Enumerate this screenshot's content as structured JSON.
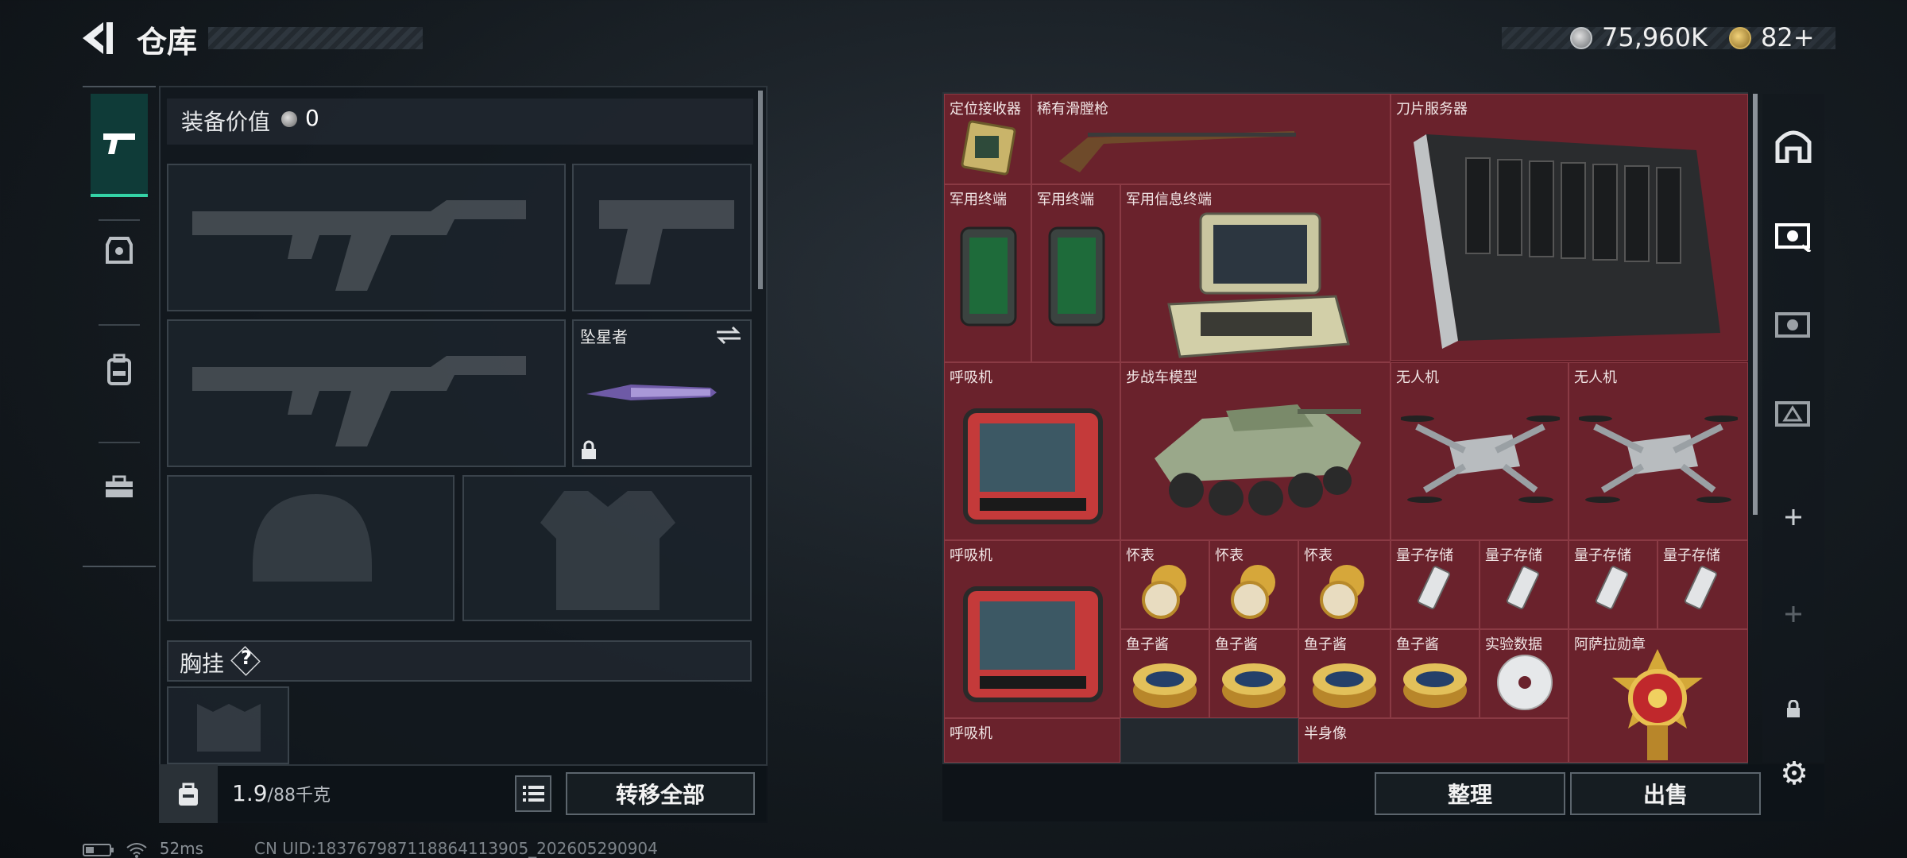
{
  "header": {
    "title": "仓库",
    "back_icon": "back-arrow-icon",
    "currency1_value": "75,960K",
    "currency2_value": "82+"
  },
  "loadout": {
    "equip_value_label": "装备价值",
    "equip_value": "0",
    "melee_name": "坠星者",
    "chest_rig_label": "胸挂",
    "chest_rig_help": "?",
    "weight_value": "1.9",
    "weight_limit": "/88千克",
    "move_all_label": "转移全部"
  },
  "left_tabs": [
    "pistol-icon",
    "armor-icon",
    "backpack-icon",
    "case-icon"
  ],
  "storage": {
    "items": [
      {
        "name": "定位接收器",
        "icon": "receiver-icon"
      },
      {
        "name": "稀有滑膛枪",
        "icon": "musket-icon"
      },
      {
        "name": "刀片服务器",
        "icon": "blade-server-icon"
      },
      {
        "name": "军用终端",
        "icon": "military-terminal-icon"
      },
      {
        "name": "军用终端",
        "icon": "military-terminal-icon"
      },
      {
        "name": "军用信息终端",
        "icon": "info-terminal-icon"
      },
      {
        "name": "呼吸机",
        "icon": "ventilator-icon"
      },
      {
        "name": "步战车模型",
        "icon": "ifv-model-icon"
      },
      {
        "name": "无人机",
        "icon": "drone-icon"
      },
      {
        "name": "无人机",
        "icon": "drone-icon"
      },
      {
        "name": "呼吸机",
        "icon": "ventilator-icon"
      },
      {
        "name": "怀表",
        "icon": "pocket-watch-icon"
      },
      {
        "name": "怀表",
        "icon": "pocket-watch-icon"
      },
      {
        "name": "怀表",
        "icon": "pocket-watch-icon"
      },
      {
        "name": "量子存储",
        "icon": "usb-drive-icon"
      },
      {
        "name": "量子存储",
        "icon": "usb-drive-icon"
      },
      {
        "name": "量子存储",
        "icon": "usb-drive-icon"
      },
      {
        "name": "量子存储",
        "icon": "usb-drive-icon"
      },
      {
        "name": "鱼子酱",
        "icon": "caviar-tin-icon"
      },
      {
        "name": "鱼子酱",
        "icon": "caviar-tin-icon"
      },
      {
        "name": "鱼子酱",
        "icon": "caviar-tin-icon"
      },
      {
        "name": "鱼子酱",
        "icon": "caviar-tin-icon"
      },
      {
        "name": "实验数据",
        "icon": "disc-icon"
      },
      {
        "name": "阿萨拉勋章",
        "icon": "medal-icon"
      },
      {
        "name": "呼吸机",
        "icon": "ventilator-icon"
      },
      {
        "name": "半身像",
        "icon": "bust-icon"
      }
    ],
    "sort_label": "整理",
    "sell_label": "出售"
  },
  "right_tabs": [
    "warehouse-icon",
    "storage-1-icon",
    "storage-4-icon",
    "storage-2-icon",
    "add-icon",
    "add-icon-dim",
    "lock-icon"
  ],
  "status": {
    "ping": "52ms",
    "uid": "CN UID:1837679871188641139​05_202605290904"
  },
  "colors": {
    "accent": "#34d3a6",
    "item_bg": "#6a222c",
    "gold": "#d1b05a"
  }
}
